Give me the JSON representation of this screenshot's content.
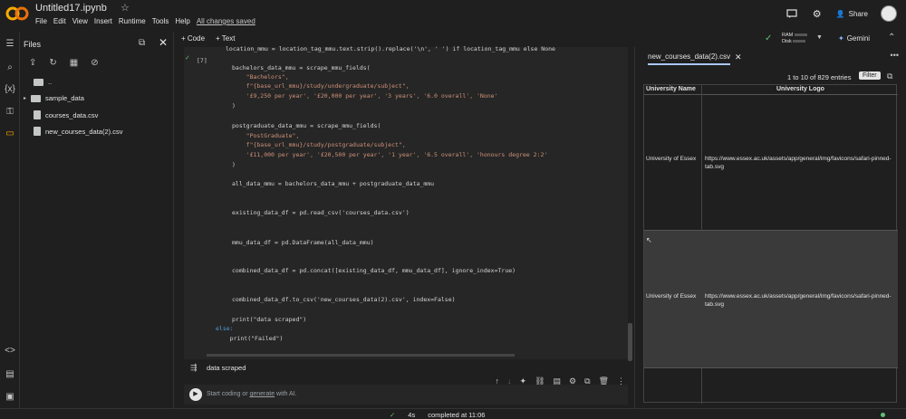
{
  "window": {
    "title": "Untitled17.ipynb"
  },
  "menu": {
    "items": [
      "File",
      "Edit",
      "View",
      "Insert",
      "Runtime",
      "Tools",
      "Help"
    ],
    "saved_status": "All changes saved"
  },
  "top_right": {
    "share_label": "Share",
    "ram_label": "RAM",
    "disk_label": "Disk",
    "gemini_label": "Gemini"
  },
  "files_panel": {
    "title": "Files",
    "items": [
      {
        "label": "..",
        "type": "folder"
      },
      {
        "label": "sample_data",
        "type": "folder"
      },
      {
        "label": "courses_data.csv",
        "type": "file"
      },
      {
        "label": "new_courses_data(2).csv",
        "type": "file"
      }
    ]
  },
  "notebook_toolbar": {
    "code_label": "+ Code",
    "text_label": "+ Text"
  },
  "cell": {
    "execution_count": "[7]",
    "lines": [
      "location_mmu = location_tag_mmu.text.strip().replace('\\n', ' ') if location_tag_mmu else None",
      "",
      "bachelors_data_mmu = scrape_mmu_fields(",
      "    \"Bachelors\",",
      "    f\"{base_url_mmu}/study/undergraduate/subject\",",
      "    '£9,250 per year', '£20,000 per year', '3 years', '6.0 overall', 'None'",
      ")",
      "",
      "postgraduate_data_mmu = scrape_mmu_fields(",
      "    \"PostGraduate\",",
      "    f\"{base_url_mmu}/study/postgraduate/subject\",",
      "    '£11,000 per year', '£20,500 per year', '1 year', '6.5 overall', 'honours degree 2:2'",
      ")",
      "",
      "all_data_mmu = bachelors_data_mmu + postgraduate_data_mmu",
      "",
      "",
      "existing_data_df = pd.read_csv('courses_data.csv')",
      "",
      "",
      "mmu_data_df = pd.DataFrame(all_data_mmu)",
      "",
      "",
      "combined_data_df = pd.concat([existing_data_df, mmu_data_df], ignore_index=True)",
      "",
      "",
      "combined_data_df.to_csv('new_courses_data(2).csv', index=False)",
      "",
      "",
      "print(\"data scraped\")",
      "else:",
      "    print(\"Failed\")"
    ],
    "output": "data scraped"
  },
  "new_cell": {
    "placeholder_prefix": "Start coding or ",
    "placeholder_link": "generate",
    "placeholder_suffix": " with AI."
  },
  "right_panel": {
    "tab_label": "new_courses_data(2).csv",
    "entries_text": "1 to 10 of 829 entries",
    "filter_label": "Filter",
    "columns": [
      "University Name",
      "University Logo"
    ],
    "rows": [
      {
        "name": "University of Essex",
        "logo": "https://www.essex.ac.uk/assets/app/general/img/favicons/safari-pinned-tab.svg"
      },
      {
        "name": "University of Essex",
        "logo": "https://www.essex.ac.uk/assets/app/general/img/favicons/safari-pinned-tab.svg"
      }
    ]
  },
  "status_bar": {
    "check": "✓",
    "duration": "4s",
    "completed": "completed at 11:06"
  }
}
